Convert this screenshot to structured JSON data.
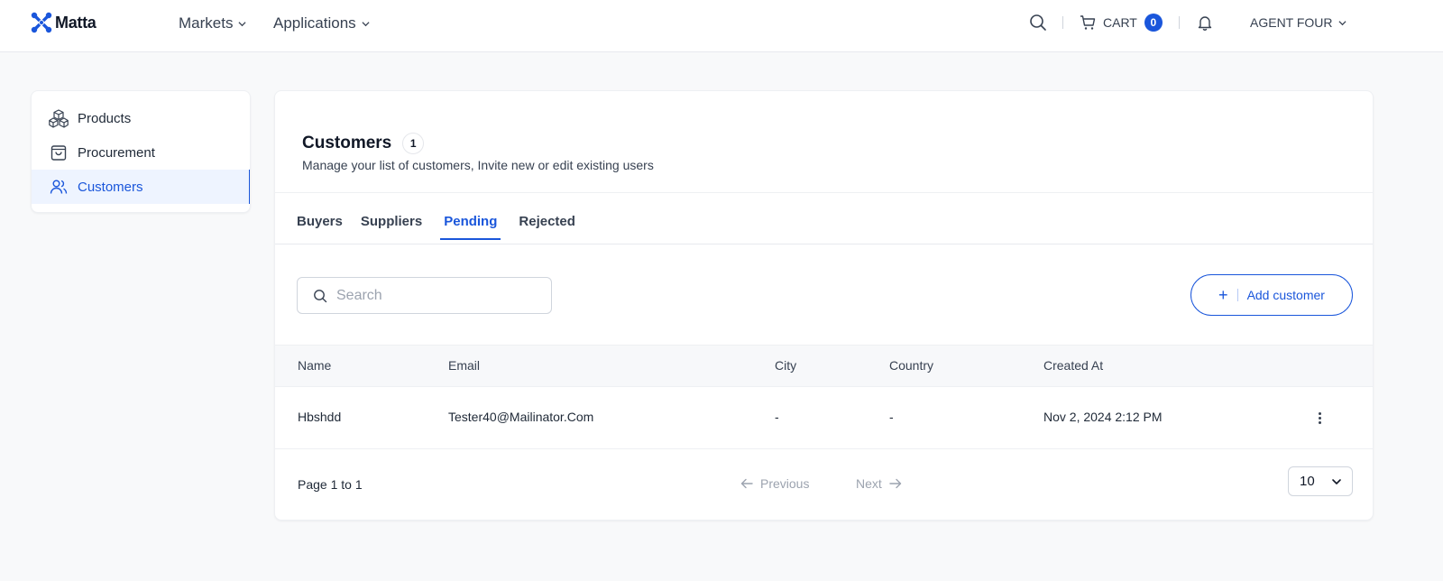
{
  "header": {
    "brand": "Matta",
    "nav": [
      {
        "label": "Markets"
      },
      {
        "label": "Applications"
      }
    ],
    "cart_label": "CART",
    "cart_count": "0",
    "user_name": "AGENT FOUR"
  },
  "sidebar": {
    "items": [
      {
        "label": "Products",
        "icon": "boxes-icon"
      },
      {
        "label": "Procurement",
        "icon": "shopping-bag-icon"
      },
      {
        "label": "Customers",
        "icon": "users-icon",
        "active": true
      }
    ]
  },
  "main": {
    "title": "Customers",
    "count": "1",
    "subtitle": "Manage your list of customers, Invite new or edit existing users",
    "tabs": [
      {
        "label": "Buyers"
      },
      {
        "label": "Suppliers"
      },
      {
        "label": "Pending",
        "active": true
      },
      {
        "label": "Rejected"
      }
    ],
    "search": {
      "placeholder": "Search",
      "value": ""
    },
    "add_button": {
      "plus": "+",
      "label": "Add customer"
    },
    "table": {
      "columns": [
        "Name",
        "Email",
        "City",
        "Country",
        "Created At"
      ],
      "rows": [
        {
          "name": "Hbshdd",
          "email": "Tester40@Mailinator.Com",
          "city": "-",
          "country": "-",
          "created_at": "Nov 2, 2024 2:12 PM"
        }
      ]
    },
    "pagination": {
      "page_text": "Page 1 to 1",
      "previous": "Previous",
      "next": "Next",
      "page_size": "10"
    }
  },
  "colors": {
    "accent": "#1a56db",
    "background": "#f8f9fa",
    "active_bg": "#eef4ff"
  }
}
